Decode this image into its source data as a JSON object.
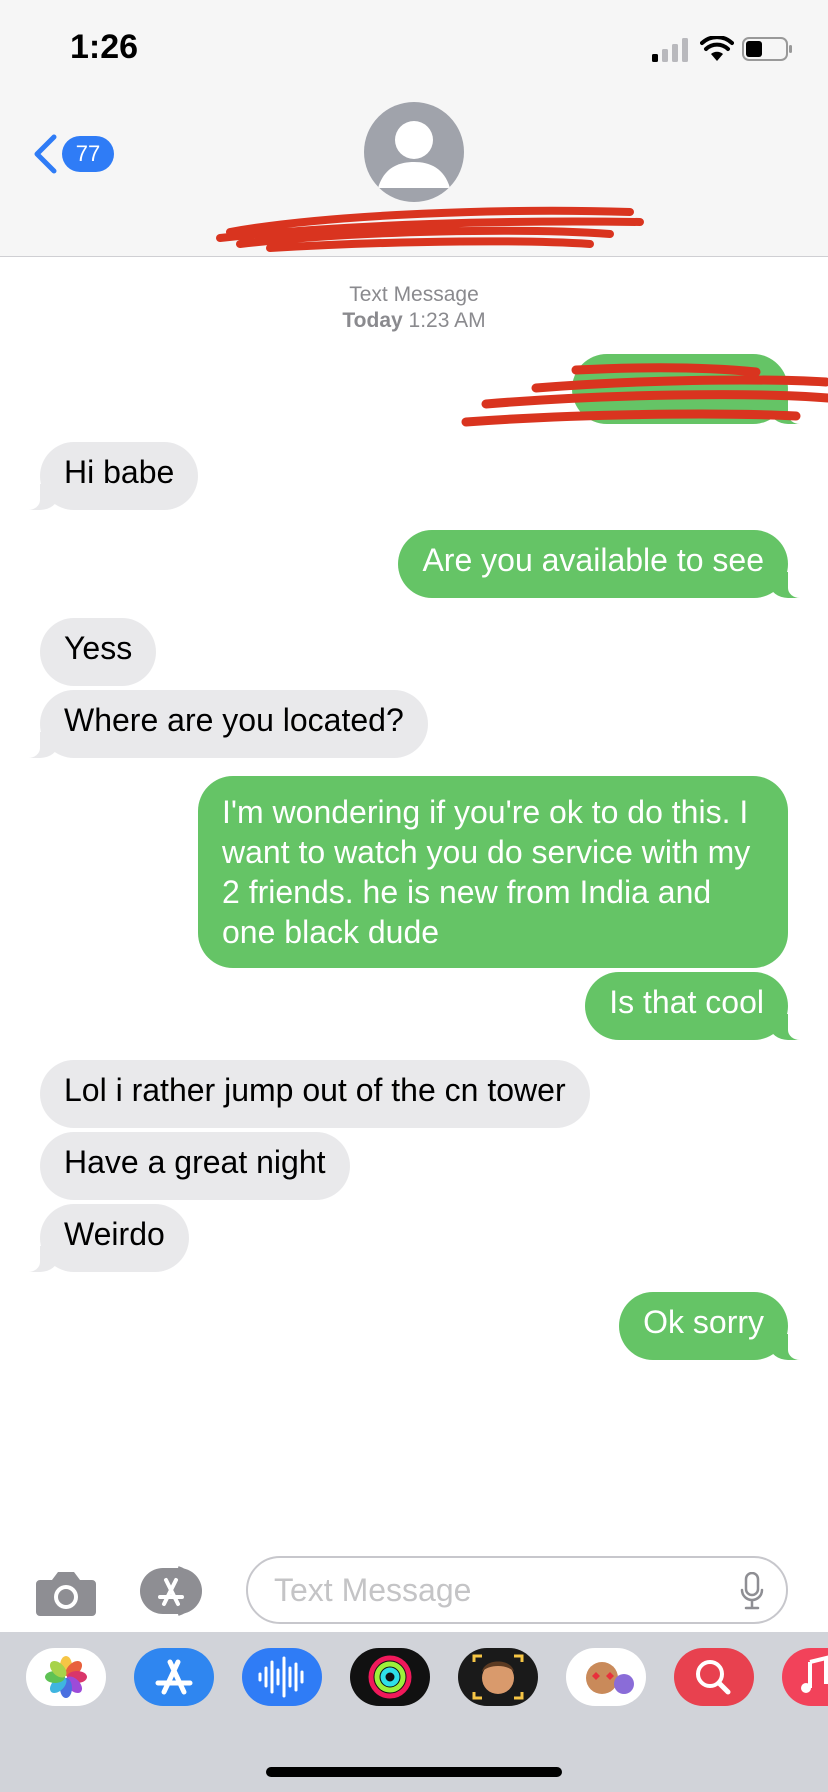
{
  "status_bar": {
    "time": "1:26"
  },
  "nav": {
    "back_count": "77"
  },
  "thread_meta": {
    "service": "Text Message",
    "timestamp_day": "Today",
    "timestamp_time": "1:23 AM"
  },
  "messages": [
    {
      "from": "me",
      "text": ""
    },
    {
      "from": "them",
      "text": "Hi babe"
    },
    {
      "from": "me",
      "text": "Are you available to see"
    },
    {
      "from": "them",
      "text": "Yess"
    },
    {
      "from": "them",
      "text": "Where are you located?"
    },
    {
      "from": "me",
      "text": "I'm wondering if you're ok to do this. I want to watch you do service with my 2 friends. he is new from India and one black dude"
    },
    {
      "from": "me",
      "text": "Is that cool"
    },
    {
      "from": "them",
      "text": "Lol i rather jump out of the cn tower"
    },
    {
      "from": "them",
      "text": "Have a great night"
    },
    {
      "from": "them",
      "text": "Weirdo"
    },
    {
      "from": "me",
      "text": "Ok sorry"
    }
  ],
  "composer": {
    "placeholder": "Text Message"
  },
  "dock_apps": [
    {
      "icon": "photos-icon"
    },
    {
      "icon": "app-store-icon"
    },
    {
      "icon": "audio-message-icon"
    },
    {
      "icon": "activity-icon"
    },
    {
      "icon": "memoji-icon"
    },
    {
      "icon": "memoji-stickers-icon"
    },
    {
      "icon": "web-search-icon"
    },
    {
      "icon": "music-icon"
    }
  ],
  "colors": {
    "outgoing": "#65c466",
    "incoming": "#e9e9eb",
    "accent": "#2f7cf6",
    "redaction": "#d9341f"
  }
}
